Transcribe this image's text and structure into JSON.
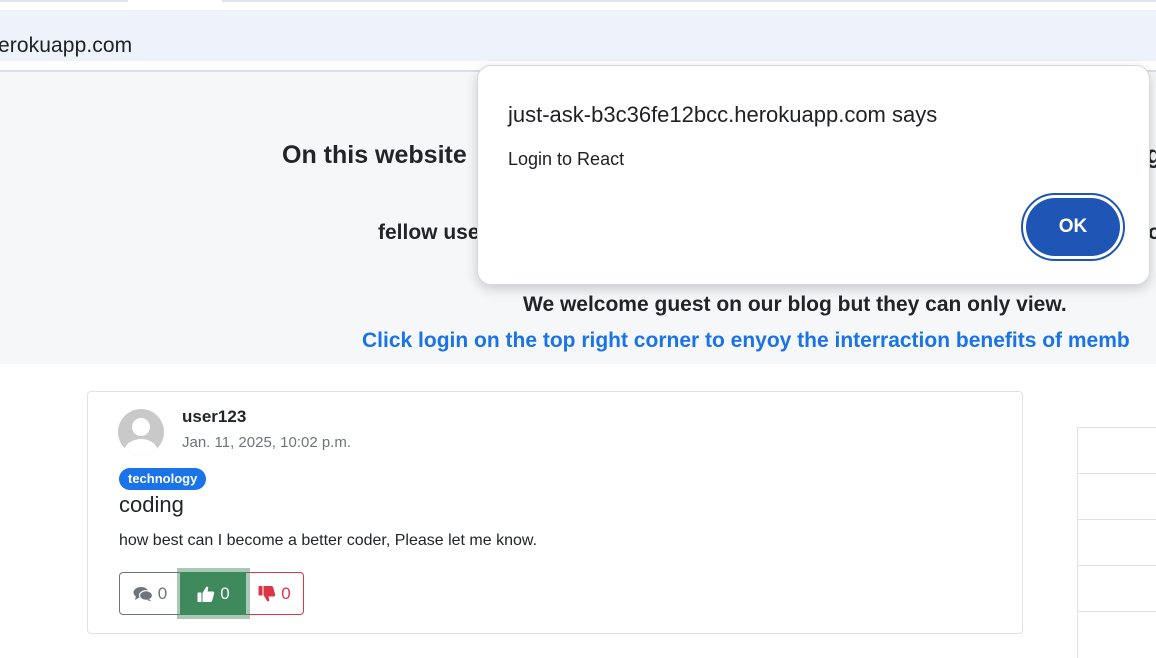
{
  "browser": {
    "address": "erokuapp.com"
  },
  "hero": {
    "line1": "On this website",
    "line1_tail": "g",
    "line2": "fellow use",
    "line2_tail": "o",
    "line3": "We welcome guest on our blog but they can only view.",
    "line4": "Click login on the top right corner to enyoy the interraction benefits of memb"
  },
  "post": {
    "author": "user123",
    "date": "Jan. 11, 2025, 10:02 p.m.",
    "tag": "technology",
    "title": "coding",
    "body": "how best can I become a better coder, Please let me know.",
    "comments_count": "0",
    "likes_count": "0",
    "dislikes_count": "0"
  },
  "dialog": {
    "title": "just-ask-b3c36fe12bcc.herokuapp.com says",
    "message": "Login to React",
    "ok_label": "OK"
  },
  "icons": {
    "comment": "comments-icon",
    "like": "thumbs-up-icon",
    "dislike": "thumbs-down-icon",
    "avatar": "user-avatar-icon"
  },
  "colors": {
    "link": "#1a73e8",
    "like_button": "#3f8a5c",
    "dislike": "#dc3545",
    "dialog_button": "#1f55b5"
  }
}
